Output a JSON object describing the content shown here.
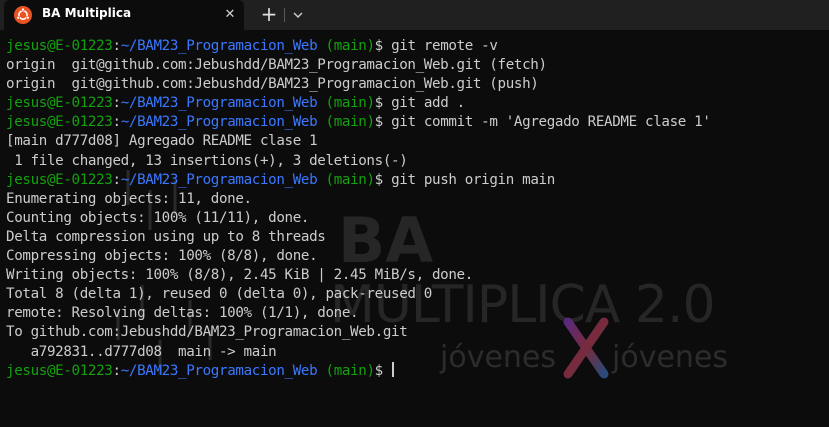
{
  "tab": {
    "title": "BA Multiplica",
    "icon": "ubuntu-icon",
    "close_symbol": "✕",
    "new_tab_symbol": "+"
  },
  "colors": {
    "background": "#0c0c0c",
    "tabbar": "#202020",
    "prompt_user": "#13a10e",
    "prompt_path": "#3b78ff",
    "text": "#cccccc",
    "ubuntu_orange": "#e95420"
  },
  "watermark": {
    "line1": "BA",
    "line2": "MULTIPLICA 2.0",
    "line3_left": "jóvenes",
    "line3_right": "jóvenes"
  },
  "prompt": {
    "user": "jesus@E-01223",
    "sep": ":",
    "path": "~/BAM23_Programacion_Web",
    "branch": "(main)",
    "symbol": "$"
  },
  "terminal": {
    "lines": [
      {
        "type": "prompt",
        "cmd": "git remote -v"
      },
      {
        "type": "output",
        "text": "origin  git@github.com:Jebushdd/BAM23_Programacion_Web.git (fetch)"
      },
      {
        "type": "output",
        "text": "origin  git@github.com:Jebushdd/BAM23_Programacion_Web.git (push)"
      },
      {
        "type": "prompt",
        "cmd": "git add ."
      },
      {
        "type": "prompt",
        "cmd": "git commit -m 'Agregado README clase 1'"
      },
      {
        "type": "output",
        "text": "[main d777d08] Agregado README clase 1"
      },
      {
        "type": "output",
        "text": " 1 file changed, 13 insertions(+), 3 deletions(-)"
      },
      {
        "type": "prompt",
        "cmd": "git push origin main"
      },
      {
        "type": "output",
        "text": "Enumerating objects: 11, done."
      },
      {
        "type": "output",
        "text": "Counting objects: 100% (11/11), done."
      },
      {
        "type": "output",
        "text": "Delta compression using up to 8 threads"
      },
      {
        "type": "output",
        "text": "Compressing objects: 100% (8/8), done."
      },
      {
        "type": "output",
        "text": "Writing objects: 100% (8/8), 2.45 KiB | 2.45 MiB/s, done."
      },
      {
        "type": "output",
        "text": "Total 8 (delta 1), reused 0 (delta 0), pack-reused 0"
      },
      {
        "type": "output",
        "text": "remote: Resolving deltas: 100% (1/1), done."
      },
      {
        "type": "output",
        "text": "To github.com:Jebushdd/BAM23_Programacion_Web.git"
      },
      {
        "type": "output",
        "text": "   a792831..d777d08  main -> main"
      },
      {
        "type": "prompt",
        "cmd": "",
        "cursor": true
      }
    ]
  }
}
